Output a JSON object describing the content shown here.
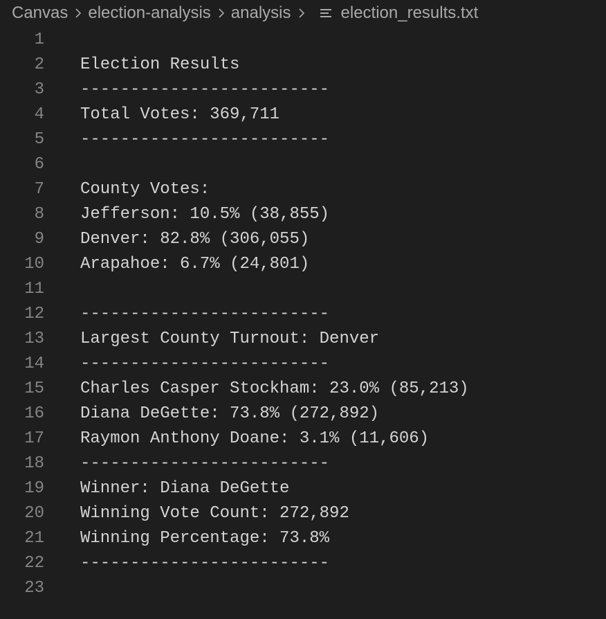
{
  "breadcrumb": {
    "items": [
      "Canvas",
      "election-analysis",
      "analysis"
    ],
    "file_icon": "text-lines-icon",
    "file_name": "election_results.txt"
  },
  "colors": {
    "background": "#1e1e1e",
    "text": "#d4d4d4",
    "line_number": "#858585",
    "breadcrumb": "#a9a9a9"
  },
  "editor": {
    "lines": [
      {
        "number": "1",
        "text": ""
      },
      {
        "number": "2",
        "text": "Election Results"
      },
      {
        "number": "3",
        "text": "-------------------------"
      },
      {
        "number": "4",
        "text": "Total Votes: 369,711"
      },
      {
        "number": "5",
        "text": "-------------------------"
      },
      {
        "number": "6",
        "text": ""
      },
      {
        "number": "7",
        "text": "County Votes:"
      },
      {
        "number": "8",
        "text": "Jefferson: 10.5% (38,855)"
      },
      {
        "number": "9",
        "text": "Denver: 82.8% (306,055)"
      },
      {
        "number": "10",
        "text": "Arapahoe: 6.7% (24,801)"
      },
      {
        "number": "11",
        "text": ""
      },
      {
        "number": "12",
        "text": "-------------------------"
      },
      {
        "number": "13",
        "text": "Largest County Turnout: Denver"
      },
      {
        "number": "14",
        "text": "-------------------------"
      },
      {
        "number": "15",
        "text": "Charles Casper Stockham: 23.0% (85,213)"
      },
      {
        "number": "16",
        "text": "Diana DeGette: 73.8% (272,892)"
      },
      {
        "number": "17",
        "text": "Raymon Anthony Doane: 3.1% (11,606)"
      },
      {
        "number": "18",
        "text": "-------------------------"
      },
      {
        "number": "19",
        "text": "Winner: Diana DeGette"
      },
      {
        "number": "20",
        "text": "Winning Vote Count: 272,892"
      },
      {
        "number": "21",
        "text": "Winning Percentage: 73.8%"
      },
      {
        "number": "22",
        "text": "-------------------------"
      },
      {
        "number": "23",
        "text": ""
      }
    ]
  }
}
